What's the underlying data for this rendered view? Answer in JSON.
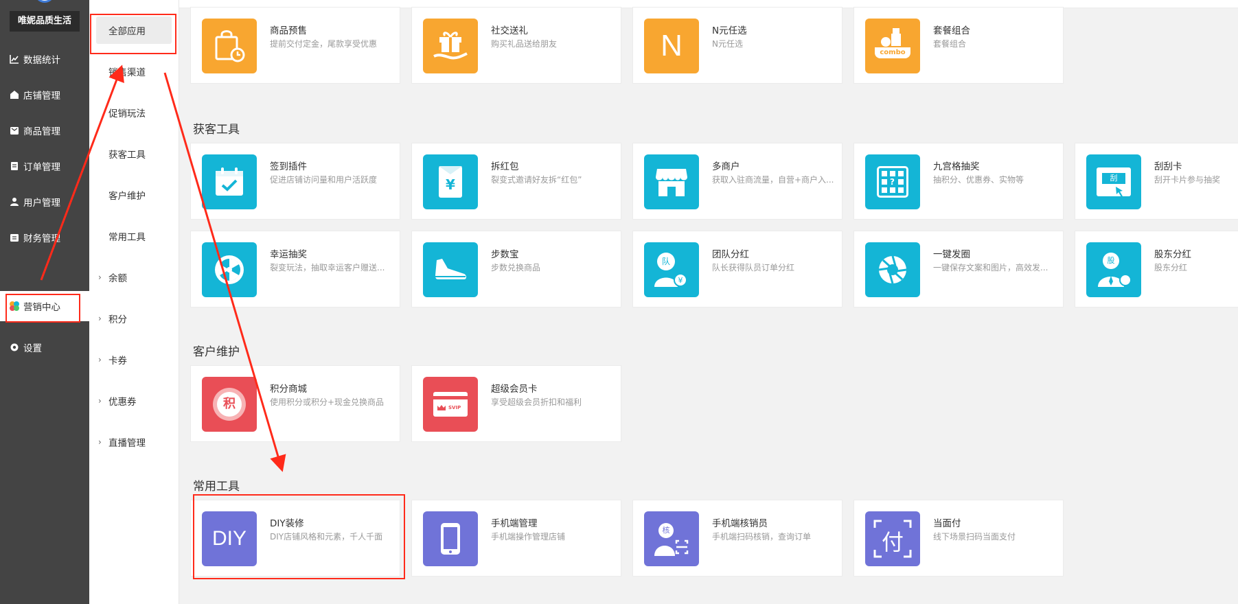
{
  "brand": {
    "name": "唯妮品质生活"
  },
  "main_nav": [
    {
      "label": "数据统计",
      "icon": "chart-icon"
    },
    {
      "label": "店铺管理",
      "icon": "store-icon"
    },
    {
      "label": "商品管理",
      "icon": "goods-icon"
    },
    {
      "label": "订单管理",
      "icon": "order-icon"
    },
    {
      "label": "用户管理",
      "icon": "user-icon"
    },
    {
      "label": "财务管理",
      "icon": "finance-icon"
    },
    {
      "label": "营销中心",
      "icon": "marketing-icon",
      "active": true
    },
    {
      "label": "设置",
      "icon": "settings-icon"
    }
  ],
  "sub_nav": [
    {
      "label": "全部应用",
      "active": true
    },
    {
      "label": "销售渠道"
    },
    {
      "label": "促销玩法"
    },
    {
      "label": "获客工具"
    },
    {
      "label": "客户维护"
    },
    {
      "label": "常用工具"
    },
    {
      "label": "余额",
      "expandable": true
    },
    {
      "label": "积分",
      "expandable": true
    },
    {
      "label": "卡券",
      "expandable": true
    },
    {
      "label": "优惠券",
      "expandable": true
    },
    {
      "label": "直播管理",
      "expandable": true
    }
  ],
  "promo_row": [
    {
      "name": "商品预售",
      "desc": "提前交付定金，尾款享受优惠",
      "icon": "presale-bag-icon",
      "color": "#f8a630"
    },
    {
      "name": "社交送礼",
      "desc": "购买礼品送给朋友",
      "icon": "gift-icon",
      "color": "#f8a630"
    },
    {
      "name": "N元任选",
      "desc": "N元任选",
      "icon": "letter-n-icon",
      "glyph": "N",
      "color": "#f8a630"
    },
    {
      "name": "套餐组合",
      "desc": "套餐组合",
      "icon": "combo-icon",
      "glyph": "combo",
      "color": "#f8a630"
    }
  ],
  "sections": {
    "acquisition": {
      "title": "获客工具",
      "apps": [
        {
          "name": "签到插件",
          "desc": "促进店铺访问量和用户活跃度",
          "icon": "calendar-check-icon"
        },
        {
          "name": "拆红包",
          "desc": "裂变式邀请好友拆“红包”",
          "icon": "red-envelope-icon",
          "glyph": "¥"
        },
        {
          "name": "多商户",
          "desc": "获取入驻商流量，自营+商户入...",
          "icon": "shop-icon"
        },
        {
          "name": "九宫格抽奖",
          "desc": "抽积分、优惠券、实物等",
          "icon": "grid-lottery-icon",
          "glyph": "?"
        },
        {
          "name": "刮刮卡",
          "desc": "刮开卡片参与抽奖",
          "icon": "scratch-card-icon",
          "glyph": "刮"
        },
        {
          "name": "幸运抽奖",
          "desc": "裂变玩法，抽取幸运客户赠送...",
          "icon": "wheel-icon"
        },
        {
          "name": "步数宝",
          "desc": "步数兑换商品",
          "icon": "sneaker-icon"
        },
        {
          "name": "团队分红",
          "desc": "队长获得队员订单分红",
          "icon": "team-dividend-icon",
          "glyph": "队"
        },
        {
          "name": "一键发圈",
          "desc": "一键保存文案和图片，高效发...",
          "icon": "aperture-icon"
        },
        {
          "name": "股东分红",
          "desc": "股东分红",
          "icon": "shareholder-icon",
          "glyph": "股"
        }
      ]
    },
    "retention": {
      "title": "客户维护",
      "apps": [
        {
          "name": "积分商城",
          "desc": "使用积分或积分+现金兑换商品",
          "icon": "points-mall-icon",
          "glyph": "积"
        },
        {
          "name": "超级会员卡",
          "desc": "享受超级会员折扣和福利",
          "icon": "svip-card-icon",
          "glyph": "SVIP"
        }
      ]
    },
    "tools": {
      "title": "常用工具",
      "apps": [
        {
          "name": "DIY装修",
          "desc": "DIY店铺风格和元素，千人千面",
          "icon": "diy-icon",
          "glyph": "DIY"
        },
        {
          "name": "手机端管理",
          "desc": "手机端操作管理店铺",
          "icon": "phone-icon"
        },
        {
          "name": "手机端核销员",
          "desc": "手机端扫码核销，查询订单",
          "icon": "verifier-icon",
          "glyph": "核"
        },
        {
          "name": "当面付",
          "desc": "线下场景扫码当面支付",
          "icon": "pay-in-person-icon",
          "glyph": "付"
        }
      ]
    }
  },
  "colors": {
    "sidebar": "#444444",
    "orange": "#f8a630",
    "teal": "#14b5d6",
    "red": "#e94e56",
    "purple": "#7073d8",
    "annotation": "#ff2a1a"
  }
}
